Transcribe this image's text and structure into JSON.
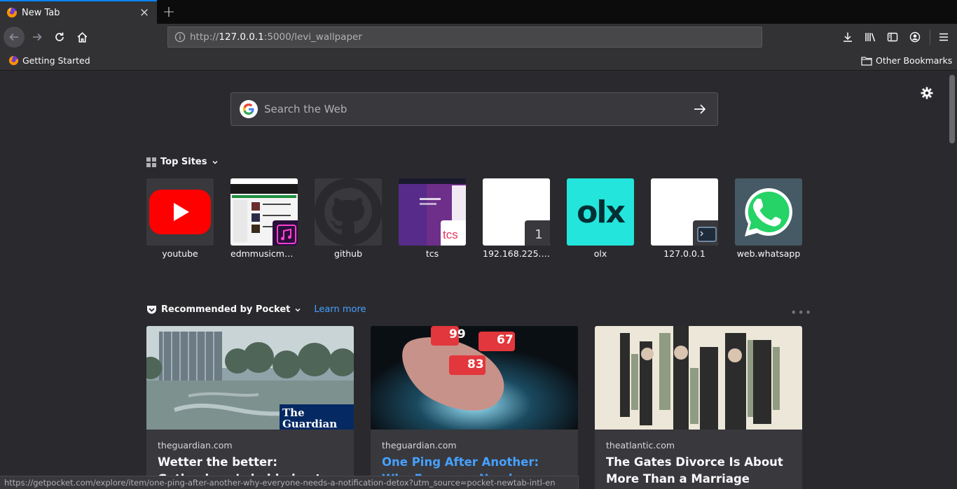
{
  "tab": {
    "title": "New Tab",
    "close_glyph": "×",
    "new_tab_glyph": "+"
  },
  "urlbar": {
    "prefix": "http://",
    "host": "127.0.0.1",
    "rest": ":5000/levi_wallpaper"
  },
  "toolbar_icons": [
    "back-icon",
    "forward-icon",
    "reload-icon",
    "home-icon",
    "download-icon",
    "library-icon",
    "sidebar-icon",
    "account-icon",
    "menu-icon"
  ],
  "bookmarks": {
    "left_label": "Getting Started",
    "right_label": "Other Bookmarks"
  },
  "search": {
    "placeholder": "Search the Web"
  },
  "top_sites": {
    "title": "Top Sites",
    "items": [
      {
        "label": "youtube"
      },
      {
        "label": "edmmusicmania"
      },
      {
        "label": "github"
      },
      {
        "label": "tcs"
      },
      {
        "label": "192.168.225.2…",
        "badge_text": "1"
      },
      {
        "label": "olx",
        "logo_text": "olx"
      },
      {
        "label": "127.0.0.1"
      },
      {
        "label": "web.whatsapp"
      }
    ]
  },
  "pocket": {
    "title": "Recommended by Pocket",
    "learn_more": "Learn more",
    "more_glyph": "•••",
    "cards": [
      {
        "source": "theguardian.com",
        "headline": "Wetter the better: Gothenburg’s bold plan to be world’s best",
        "overlay": "The Guardian"
      },
      {
        "source": "theguardian.com",
        "headline": "One Ping After Another: Why Everyone Needs a Notification",
        "badges": [
          "99",
          "67",
          "83"
        ]
      },
      {
        "source": "theatlantic.com",
        "headline": "The Gates Divorce Is About More Than a Marriage"
      }
    ]
  },
  "status_bar": {
    "text": "https://getpocket.com/explore/item/one-ping-after-another-why-everyone-needs-a-notification-detox?utm_source=pocket-newtab-intl-en"
  },
  "colors": {
    "accent": "#0a84ff",
    "link": "#45a1ff",
    "youtube": "#ff0000",
    "olx": "#23e5db",
    "whatsapp_tile": "#455a64"
  }
}
